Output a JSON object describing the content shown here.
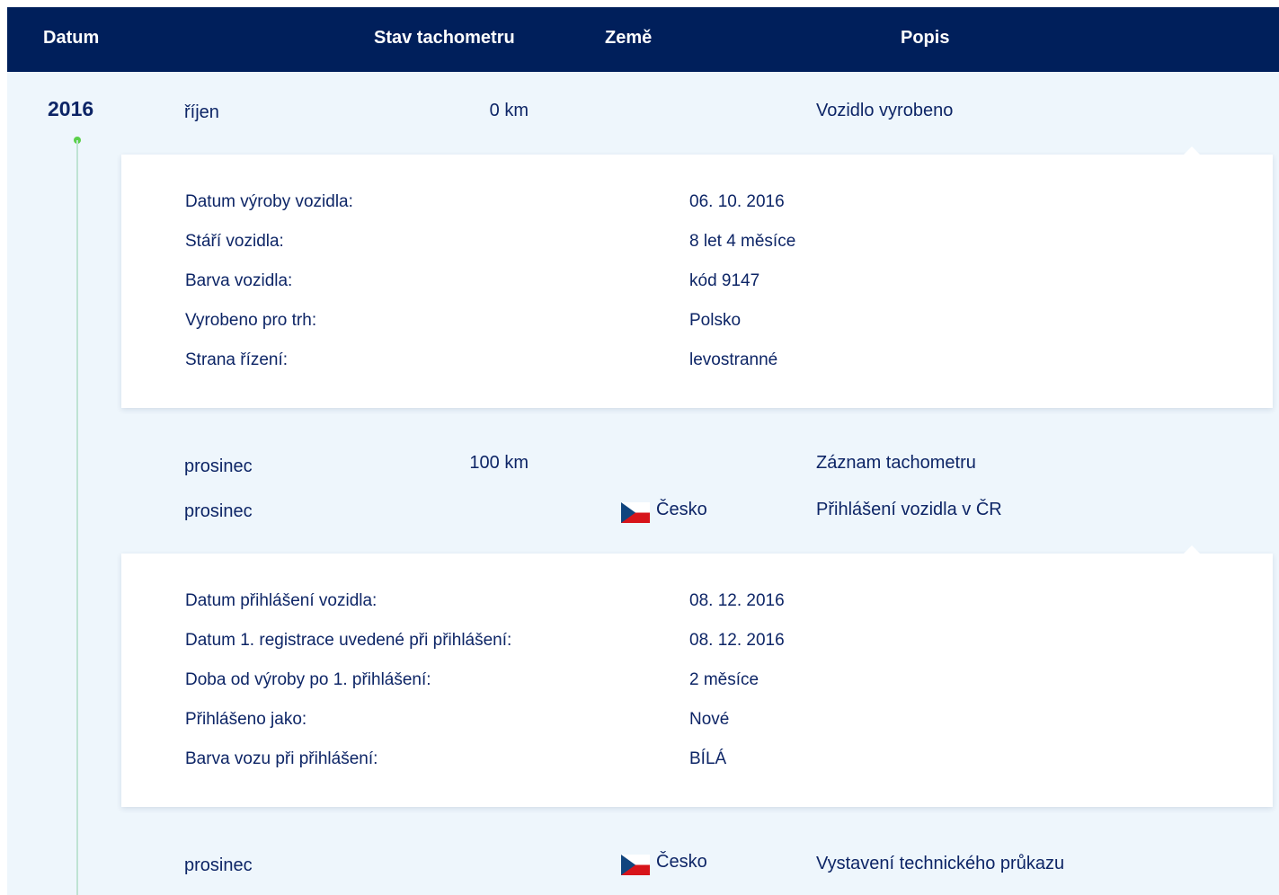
{
  "header": {
    "col_date": "Datum",
    "col_odometer": "Stav tachometru",
    "col_country": "Země",
    "col_description": "Popis"
  },
  "timeline": {
    "year": "2016",
    "events": [
      {
        "month": "říjen",
        "odometer": "0 km",
        "country": "",
        "description": "Vozidlo vyrobeno"
      },
      {
        "month": "prosinec",
        "odometer": "100 km",
        "country": "",
        "description": "Záznam tachometru"
      },
      {
        "month": "prosinec",
        "odometer": "",
        "country": "Česko",
        "description": "Přihlášení vozidla v ČR"
      },
      {
        "month": "prosinec",
        "odometer": "",
        "country": "Česko",
        "description": "Vystavení technického průkazu"
      }
    ],
    "detail_1": [
      {
        "label": "Datum výroby vozidla:",
        "value": "06. 10. 2016"
      },
      {
        "label": "Stáří vozidla:",
        "value": "8 let 4 měsíce"
      },
      {
        "label": "Barva vozidla:",
        "value": "kód 9147"
      },
      {
        "label": "Vyrobeno pro trh:",
        "value": "Polsko"
      },
      {
        "label": "Strana řízení:",
        "value": "levostranné"
      }
    ],
    "detail_2": [
      {
        "label": "Datum přihlášení vozidla:",
        "value": "08. 12. 2016"
      },
      {
        "label": "Datum 1. registrace uvedené při přihlášení:",
        "value": "08. 12. 2016"
      },
      {
        "label": "Doba od výroby po 1. přihlášení:",
        "value": "2 měsíce"
      },
      {
        "label": "Přihlášeno jako:",
        "value": "Nové"
      },
      {
        "label": "Barva vozu při přihlášení:",
        "value": "BÍLÁ"
      }
    ]
  },
  "colors": {
    "header_bg": "#001f5b",
    "page_bg": "#eef6fc",
    "text": "#0d2566",
    "timeline_dot": "#5bd04a"
  },
  "icons": {
    "flag": "czech-flag-icon"
  }
}
